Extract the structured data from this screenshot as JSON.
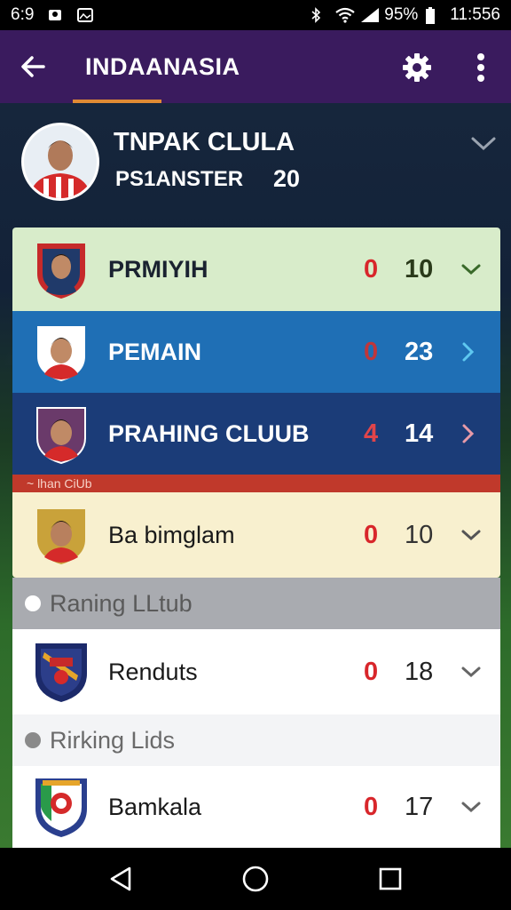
{
  "status_bar": {
    "left_text": "6:9",
    "battery": "95%",
    "time": "11:556"
  },
  "app_bar": {
    "title": "INDAANASIA"
  },
  "profile": {
    "name": "TNPAK CLULA",
    "subtitle": "PS1ANSTER",
    "number": "20"
  },
  "rows": [
    {
      "label": "PRMIYIH",
      "score_a": "0",
      "score_b": "10",
      "chevron": "chevron-down"
    },
    {
      "label": "PEMAIN",
      "score_a": "0",
      "score_b": "23",
      "chevron": "chevron-right"
    },
    {
      "label": "PRAHING CLUUB",
      "score_a": "4",
      "score_b": "14",
      "chevron": "chevron-right"
    },
    {
      "label": "Ba bimglam",
      "score_a": "0",
      "score_b": "10",
      "chevron": "chevron-down"
    }
  ],
  "banner_text": "~ lhan CiUb",
  "sections": [
    {
      "title": "Raning LLtub"
    },
    {
      "title": "Rirking Lids"
    }
  ],
  "club_rows": [
    {
      "label": "Renduts",
      "score_a": "0",
      "score_b": "18"
    },
    {
      "label": "Bamkala",
      "score_a": "0",
      "score_b": "17"
    }
  ],
  "colors": {
    "app_bar": "#3a1b5e",
    "accent": "#e08a34",
    "score_red": "#d8262b",
    "row1_bg": "#d8ecca",
    "row2_bg": "#1f6fb5",
    "row3_bg": "#1b3c78",
    "row4_bg": "#f8f0cf"
  }
}
